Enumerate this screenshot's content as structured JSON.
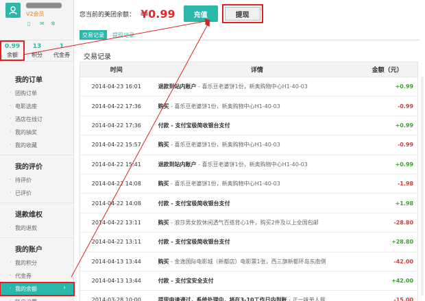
{
  "profile": {
    "vip": "V2会员",
    "icons": [
      "phone-icon",
      "mail-icon",
      "gear-icon"
    ]
  },
  "stats": [
    {
      "value": "0.99",
      "label": "余额"
    },
    {
      "value": "13",
      "label": "积分"
    },
    {
      "value": "1",
      "label": "代金券"
    }
  ],
  "nav": [
    {
      "title": "我的订单",
      "items": [
        "团购订单",
        "电影选座",
        "酒店在线订",
        "我的抽奖",
        "我的收藏"
      ]
    },
    {
      "title": "我的评价",
      "items": [
        "待评价",
        "已评价"
      ]
    },
    {
      "title": "退款维权",
      "items": [
        "我的退款"
      ]
    },
    {
      "title": "我的账户",
      "items": [
        "我的积分",
        "代金券",
        "我的余额",
        "账户设置"
      ]
    }
  ],
  "header": {
    "balance_label": "您当前的美团余额：",
    "balance_value": "¥0.99",
    "recharge": "充值",
    "withdraw": "提现"
  },
  "tabs": [
    "交易记录",
    "提现记录"
  ],
  "section_title": "交易记录",
  "table": {
    "headers": [
      "时间",
      "详情",
      "金额（元）"
    ],
    "rows": [
      {
        "time": "2014-04-23 16:01",
        "main": "退款到站内账户",
        "sub": " - 喜乐豆老婆饼1份，新奥购物中心H1-40-03",
        "amount": "+0.99",
        "sign": "pos"
      },
      {
        "time": "2014-04-22 17:36",
        "main": "购买",
        "sub": " - 喜乐豆老婆饼1份，新奥购物中心H1-40-03",
        "amount": "-0.99",
        "sign": "neg"
      },
      {
        "time": "2014-04-22 17:36",
        "main": "付款 - 支付宝极简收银台支付",
        "sub": "",
        "amount": "+0.99",
        "sign": "pos"
      },
      {
        "time": "2014-04-22 15:57",
        "main": "购买",
        "sub": " - 喜乐豆老婆饼1份，新奥购物中心H1-40-03",
        "amount": "-0.99",
        "sign": "neg"
      },
      {
        "time": "2014-04-22 15:41",
        "main": "退款到站内账户",
        "sub": " - 喜乐豆老婆饼1份，新奥购物中心H1-40-03",
        "amount": "+0.99",
        "sign": "pos"
      },
      {
        "time": "2014-04-22 14:08",
        "main": "购买",
        "sub": " - 喜乐豆老婆饼1份，新奥购物中心H1-40-03",
        "amount": "-1.98",
        "sign": "neg"
      },
      {
        "time": "2014-04-22 14:08",
        "main": "付款 - 支付宝极简收银台支付",
        "sub": "",
        "amount": "+1.98",
        "sign": "pos"
      },
      {
        "time": "2014-04-22 13:11",
        "main": "购买",
        "sub": " - 浪莎男女款休闲透气百搭背心1件，购买2件及以上全国包邮",
        "amount": "-28.80",
        "sign": "neg"
      },
      {
        "time": "2014-04-22 13:11",
        "main": "付款 - 支付宝极简收银台支付",
        "sub": "",
        "amount": "+28.80",
        "sign": "pos"
      },
      {
        "time": "2014-04-13 13:44",
        "main": "购买",
        "sub": " - 金逸国际电影城（新都店）电影票1张，西三旗新都环岛东南侧",
        "amount": "-42.00",
        "sign": "neg"
      },
      {
        "time": "2014-04-13 13:44",
        "main": "付款 - 支付宝安全支付",
        "sub": "",
        "amount": "+42.00",
        "sign": "pos"
      },
      {
        "time": "2014-03-28 10:00",
        "main": "提现申请通过，系统处理中，将在3-10工作日内到账",
        "sub": " - 正一味单人餐",
        "amount": "-15.00",
        "sign": "neg"
      }
    ]
  },
  "colors": {
    "accent": "#2bb8aa",
    "negative": "#d83a3a",
    "positive": "#3aa02c",
    "annotation": "#e02020"
  }
}
